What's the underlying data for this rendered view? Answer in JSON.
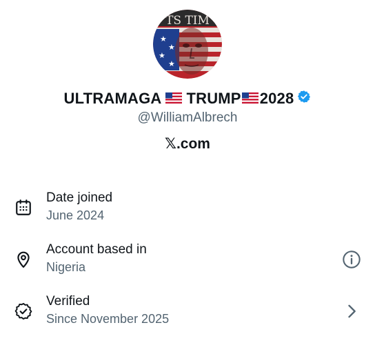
{
  "profile": {
    "avatar_icon": "profile-avatar",
    "avatar_text": "TS TIM",
    "name_part1": "ULTRAMAGA",
    "name_part2": "TRUMP",
    "name_part3": "2028",
    "flag_icon": "us-flag",
    "verified_icon": "blue-check-badge",
    "verified_color": "#1d9bf0",
    "handle": "@WilliamAlbrech",
    "site": "𝕏.com"
  },
  "details": [
    {
      "icon": "calendar-icon",
      "title": "Date joined",
      "value": "June 2024"
    },
    {
      "icon": "location-pin-icon",
      "title": "Account based in",
      "value": "Nigeria",
      "trailing_icon": "info-icon"
    },
    {
      "icon": "verified-badge-icon",
      "title": "Verified",
      "value": "Since November 2025",
      "trailing_icon": "chevron-right-icon"
    }
  ],
  "colors": {
    "primary_text": "#0f1419",
    "secondary_text": "#536471",
    "accent": "#1d9bf0"
  }
}
